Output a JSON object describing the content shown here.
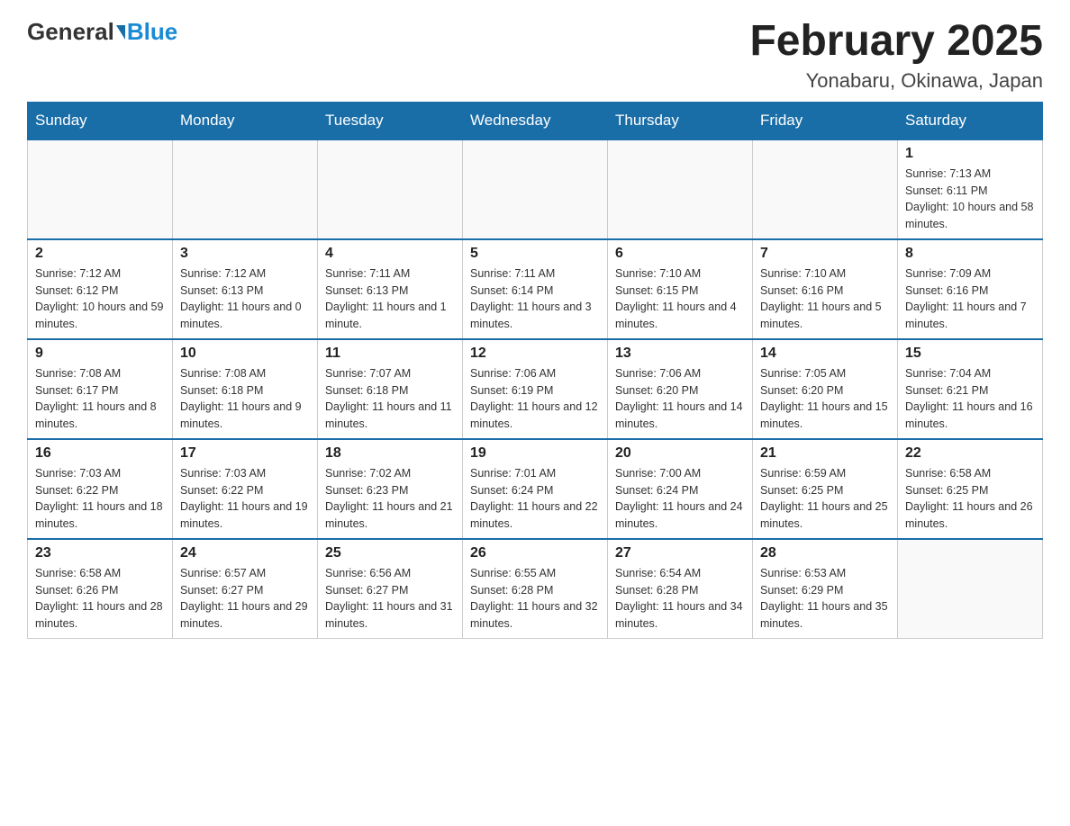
{
  "header": {
    "logo_general": "General",
    "logo_blue": "Blue",
    "month_title": "February 2025",
    "location": "Yonabaru, Okinawa, Japan"
  },
  "days_of_week": [
    "Sunday",
    "Monday",
    "Tuesday",
    "Wednesday",
    "Thursday",
    "Friday",
    "Saturday"
  ],
  "weeks": [
    [
      {
        "day": "",
        "info": ""
      },
      {
        "day": "",
        "info": ""
      },
      {
        "day": "",
        "info": ""
      },
      {
        "day": "",
        "info": ""
      },
      {
        "day": "",
        "info": ""
      },
      {
        "day": "",
        "info": ""
      },
      {
        "day": "1",
        "info": "Sunrise: 7:13 AM\nSunset: 6:11 PM\nDaylight: 10 hours and 58 minutes."
      }
    ],
    [
      {
        "day": "2",
        "info": "Sunrise: 7:12 AM\nSunset: 6:12 PM\nDaylight: 10 hours and 59 minutes."
      },
      {
        "day": "3",
        "info": "Sunrise: 7:12 AM\nSunset: 6:13 PM\nDaylight: 11 hours and 0 minutes."
      },
      {
        "day": "4",
        "info": "Sunrise: 7:11 AM\nSunset: 6:13 PM\nDaylight: 11 hours and 1 minute."
      },
      {
        "day": "5",
        "info": "Sunrise: 7:11 AM\nSunset: 6:14 PM\nDaylight: 11 hours and 3 minutes."
      },
      {
        "day": "6",
        "info": "Sunrise: 7:10 AM\nSunset: 6:15 PM\nDaylight: 11 hours and 4 minutes."
      },
      {
        "day": "7",
        "info": "Sunrise: 7:10 AM\nSunset: 6:16 PM\nDaylight: 11 hours and 5 minutes."
      },
      {
        "day": "8",
        "info": "Sunrise: 7:09 AM\nSunset: 6:16 PM\nDaylight: 11 hours and 7 minutes."
      }
    ],
    [
      {
        "day": "9",
        "info": "Sunrise: 7:08 AM\nSunset: 6:17 PM\nDaylight: 11 hours and 8 minutes."
      },
      {
        "day": "10",
        "info": "Sunrise: 7:08 AM\nSunset: 6:18 PM\nDaylight: 11 hours and 9 minutes."
      },
      {
        "day": "11",
        "info": "Sunrise: 7:07 AM\nSunset: 6:18 PM\nDaylight: 11 hours and 11 minutes."
      },
      {
        "day": "12",
        "info": "Sunrise: 7:06 AM\nSunset: 6:19 PM\nDaylight: 11 hours and 12 minutes."
      },
      {
        "day": "13",
        "info": "Sunrise: 7:06 AM\nSunset: 6:20 PM\nDaylight: 11 hours and 14 minutes."
      },
      {
        "day": "14",
        "info": "Sunrise: 7:05 AM\nSunset: 6:20 PM\nDaylight: 11 hours and 15 minutes."
      },
      {
        "day": "15",
        "info": "Sunrise: 7:04 AM\nSunset: 6:21 PM\nDaylight: 11 hours and 16 minutes."
      }
    ],
    [
      {
        "day": "16",
        "info": "Sunrise: 7:03 AM\nSunset: 6:22 PM\nDaylight: 11 hours and 18 minutes."
      },
      {
        "day": "17",
        "info": "Sunrise: 7:03 AM\nSunset: 6:22 PM\nDaylight: 11 hours and 19 minutes."
      },
      {
        "day": "18",
        "info": "Sunrise: 7:02 AM\nSunset: 6:23 PM\nDaylight: 11 hours and 21 minutes."
      },
      {
        "day": "19",
        "info": "Sunrise: 7:01 AM\nSunset: 6:24 PM\nDaylight: 11 hours and 22 minutes."
      },
      {
        "day": "20",
        "info": "Sunrise: 7:00 AM\nSunset: 6:24 PM\nDaylight: 11 hours and 24 minutes."
      },
      {
        "day": "21",
        "info": "Sunrise: 6:59 AM\nSunset: 6:25 PM\nDaylight: 11 hours and 25 minutes."
      },
      {
        "day": "22",
        "info": "Sunrise: 6:58 AM\nSunset: 6:25 PM\nDaylight: 11 hours and 26 minutes."
      }
    ],
    [
      {
        "day": "23",
        "info": "Sunrise: 6:58 AM\nSunset: 6:26 PM\nDaylight: 11 hours and 28 minutes."
      },
      {
        "day": "24",
        "info": "Sunrise: 6:57 AM\nSunset: 6:27 PM\nDaylight: 11 hours and 29 minutes."
      },
      {
        "day": "25",
        "info": "Sunrise: 6:56 AM\nSunset: 6:27 PM\nDaylight: 11 hours and 31 minutes."
      },
      {
        "day": "26",
        "info": "Sunrise: 6:55 AM\nSunset: 6:28 PM\nDaylight: 11 hours and 32 minutes."
      },
      {
        "day": "27",
        "info": "Sunrise: 6:54 AM\nSunset: 6:28 PM\nDaylight: 11 hours and 34 minutes."
      },
      {
        "day": "28",
        "info": "Sunrise: 6:53 AM\nSunset: 6:29 PM\nDaylight: 11 hours and 35 minutes."
      },
      {
        "day": "",
        "info": ""
      }
    ]
  ]
}
